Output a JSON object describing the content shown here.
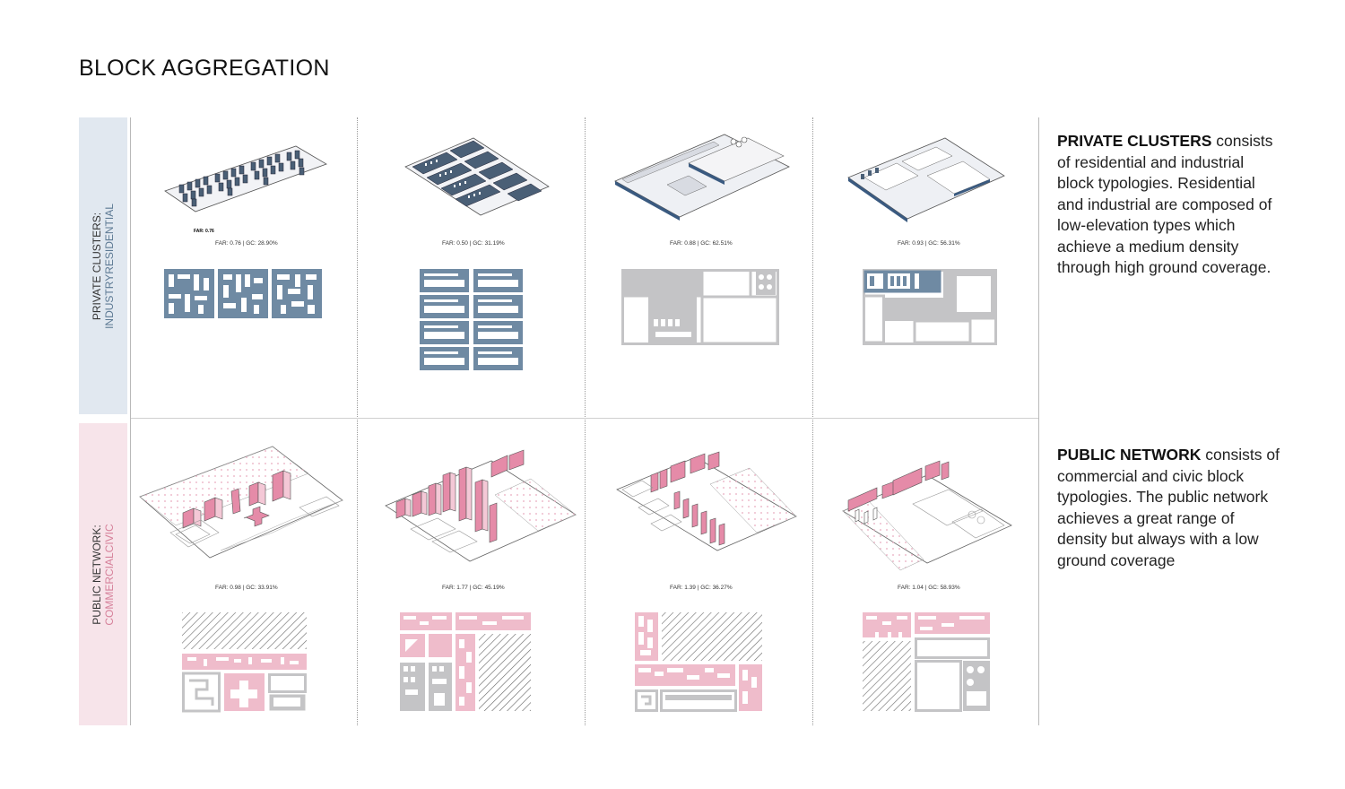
{
  "title": "BLOCK AGGREGATION",
  "rows": [
    {
      "label_line1": "PRIVATE CLUSTERS:",
      "label_line2": "INDUSTRYRESIDENTIAL",
      "accent": "#5d7a94",
      "cells": [
        {
          "caption": "FAR: 0.76 | GC: 28.90%"
        },
        {
          "caption": "FAR: 0.50 | GC: 31.19%"
        },
        {
          "caption": "FAR: 0.88 | GC: 62.51%"
        },
        {
          "caption": "FAR: 0.93 | GC: 56.31%"
        }
      ]
    },
    {
      "label_line1": "PUBLIC NETWORK:",
      "label_line2": "COMMERCIALCIVIC",
      "accent": "#e8a9bd",
      "cells": [
        {
          "caption": "FAR: 0.98 | GC: 33.91%"
        },
        {
          "caption": "FAR: 1.77 | GC: 45.19%"
        },
        {
          "caption": "FAR: 1.39 | GC: 36.27%"
        },
        {
          "caption": "FAR: 1.04 | GC: 58.93%"
        }
      ]
    }
  ],
  "descriptions": [
    {
      "heading": "PRIVATE CLUSTERS",
      "body": " consists of residential and industrial block typologies. Residential and industrial are composed of low-elevation types which achieve a medium density through high ground coverage."
    },
    {
      "heading": "PUBLIC NETWORK",
      "body": " consists of commercial and civic block typologies. The public network achieves a great range of density but always with a low ground coverage"
    }
  ],
  "colors": {
    "private": "#5d7a94",
    "public": "#e8a9bd",
    "neutral": "#c4c4c6",
    "private_band": "#e1e8f0",
    "public_band": "#f7e4ea"
  }
}
